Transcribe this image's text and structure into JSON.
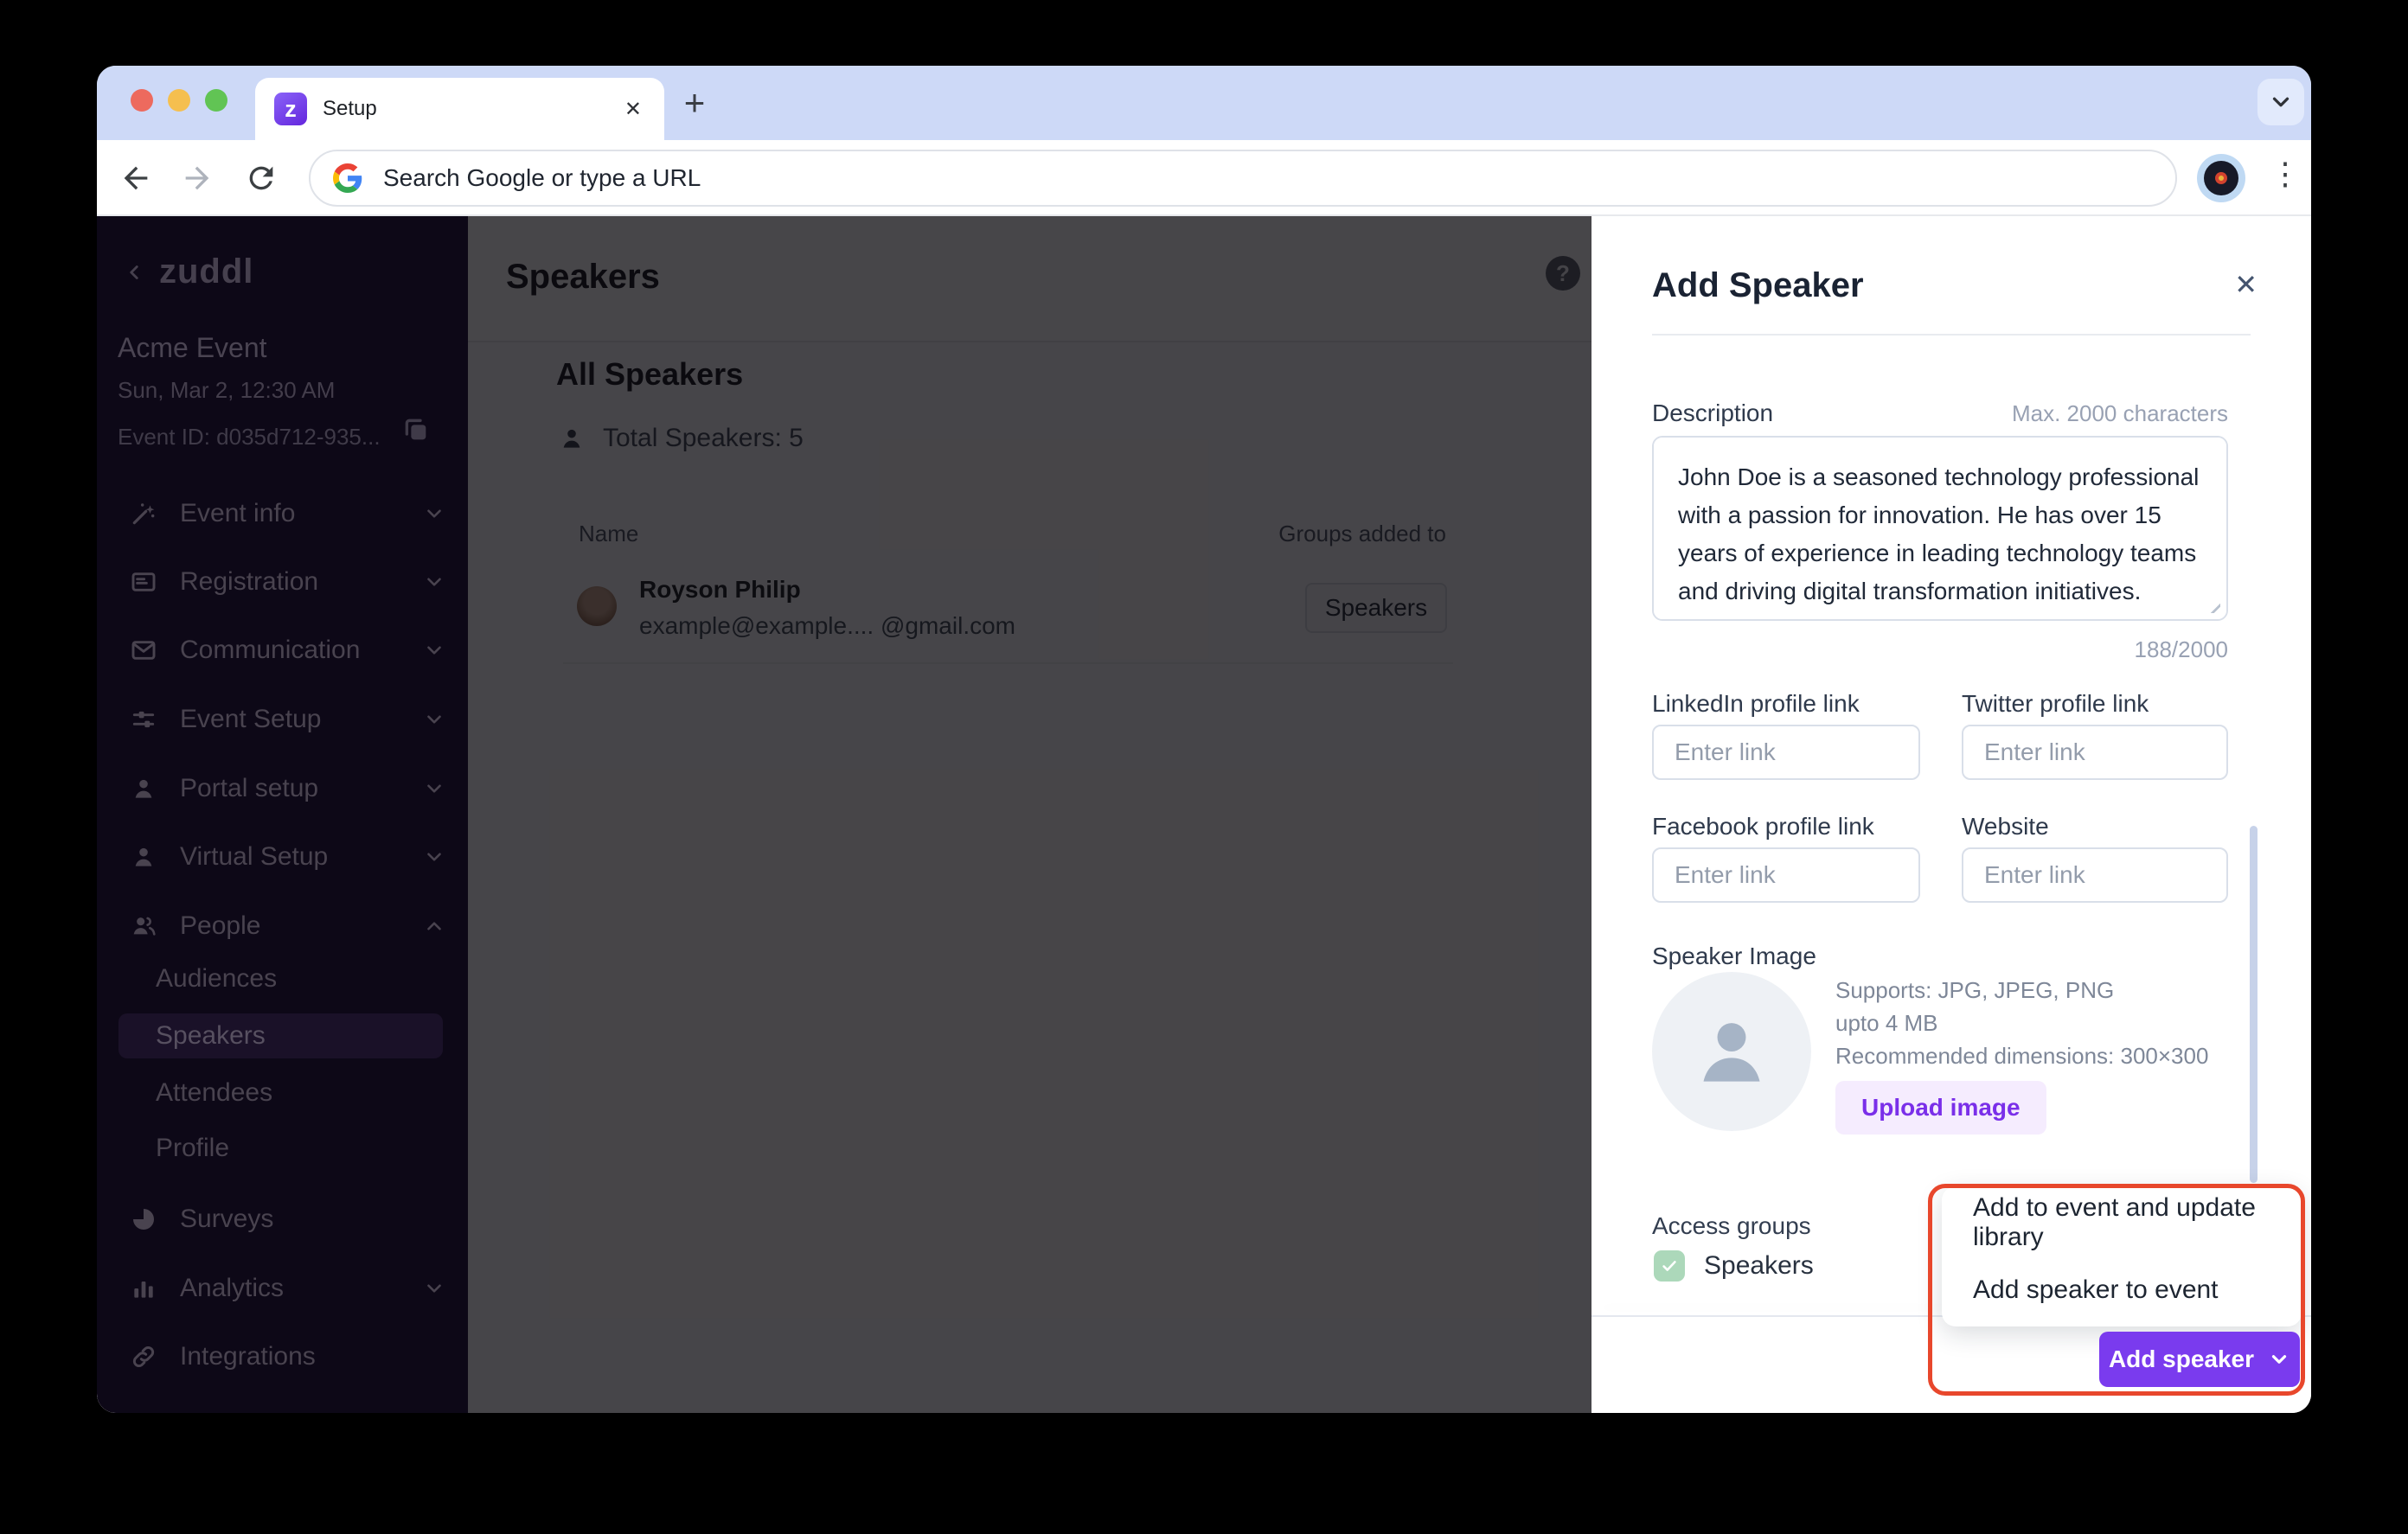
{
  "colors": {
    "accent_purple": "#7A3BEE",
    "annotation_red": "#E8472C",
    "tabstrip": "#CDD9F7",
    "sidebar_bg": "#0D0817",
    "checkbox_green": "#ACD8BA",
    "upload_bg": "#F5ECFE",
    "upload_text": "#7A2FE9"
  },
  "browser": {
    "tab": {
      "title": "Setup",
      "favicon_glyph": "z",
      "close_glyph": "✕",
      "new_tab_glyph": "+"
    },
    "toolbar": {
      "url_text": "Search Google or type a URL",
      "menu_glyph": "⋮"
    }
  },
  "sidebar": {
    "logo": "zuddl",
    "event": {
      "name": "Acme Event",
      "datetime": "Sun, Mar 2, 12:30 AM",
      "id": "Event ID: d035d712-935..."
    },
    "items": [
      {
        "label": "Event info"
      },
      {
        "label": "Registration"
      },
      {
        "label": "Communication"
      },
      {
        "label": "Event Setup"
      },
      {
        "label": "Portal setup"
      },
      {
        "label": "Virtual Setup"
      },
      {
        "label": "People"
      },
      {
        "label": "Surveys"
      },
      {
        "label": "Analytics"
      },
      {
        "label": "Integrations"
      }
    ],
    "people_sub": [
      {
        "label": "Audiences"
      },
      {
        "label": "Speakers",
        "active": true
      },
      {
        "label": "Attendees"
      },
      {
        "label": "Profile"
      }
    ]
  },
  "main": {
    "page_title": "Speakers",
    "help_glyph": "?",
    "section_title": "All Speakers",
    "total_speakers": "Total Speakers: 5",
    "table": {
      "columns": [
        "Name",
        "Groups added to"
      ],
      "rows": [
        {
          "name": "Royson Philip",
          "email": "example@example.... @gmail.com",
          "group": "Speakers"
        }
      ]
    }
  },
  "panel": {
    "title": "Add Speaker",
    "close_glyph": "✕",
    "description": {
      "label": "Description",
      "hint": "Max. 2000 characters",
      "value": "John Doe is a seasoned technology professional with a passion for innovation. He has over 15 years of experience in leading technology teams and driving digital transformation initiatives.",
      "counter": "188/2000"
    },
    "links": [
      {
        "label": "LinkedIn profile link",
        "placeholder": "Enter link"
      },
      {
        "label": "Twitter profile link",
        "placeholder": "Enter link"
      },
      {
        "label": "Facebook profile link",
        "placeholder": "Enter link"
      },
      {
        "label": "Website",
        "placeholder": "Enter link"
      }
    ],
    "speaker_image": {
      "label": "Speaker Image",
      "support_line1": "Supports: JPG, JPEG, PNG",
      "support_line2": "upto 4 MB",
      "support_line3": "Recommended dimensions: 300×300",
      "upload_label": "Upload image"
    },
    "access_groups": {
      "label": "Access groups",
      "options": [
        {
          "label": "Speakers",
          "checked": true
        }
      ]
    },
    "dropdown": {
      "items": [
        "Add to event and update library",
        "Add speaker to event"
      ]
    },
    "footer": {
      "add_button_label": "Add speaker"
    }
  }
}
